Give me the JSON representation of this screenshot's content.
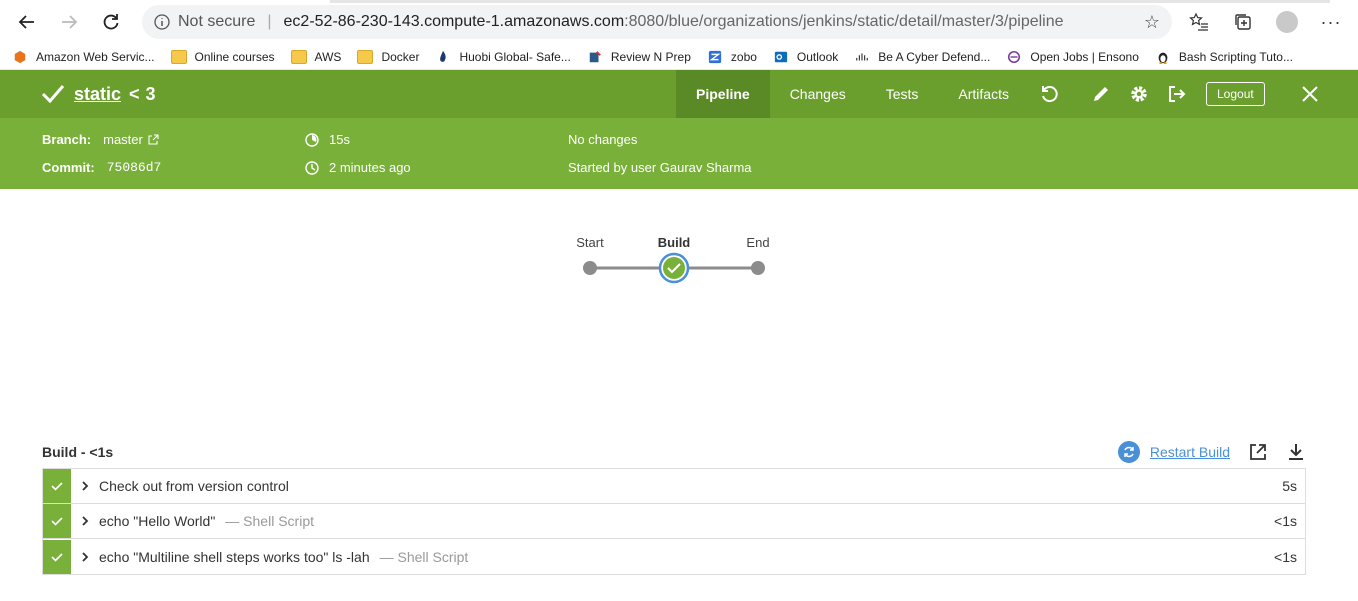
{
  "browser": {
    "security": "Not secure",
    "url_host": "ec2-52-86-230-143.compute-1.amazonaws.com",
    "url_rest": ":8080/blue/organizations/jenkins/static/detail/master/3/pipeline",
    "bookmarks": [
      {
        "label": "Amazon Web Servic...",
        "icon": "aws-icon"
      },
      {
        "label": "Online courses",
        "icon": "folder-icon"
      },
      {
        "label": "AWS",
        "icon": "folder-icon"
      },
      {
        "label": "Docker",
        "icon": "folder-icon"
      },
      {
        "label": "Huobi Global- Safe...",
        "icon": "huobi-icon"
      },
      {
        "label": "Review N Prep",
        "icon": "review-icon"
      },
      {
        "label": "zobo",
        "icon": "zobo-icon"
      },
      {
        "label": "Outlook",
        "icon": "outlook-icon"
      },
      {
        "label": "Be A Cyber Defend...",
        "icon": "cisco-icon"
      },
      {
        "label": "Open Jobs | Ensono",
        "icon": "ensono-icon"
      },
      {
        "label": "Bash Scripting Tuto...",
        "icon": "linux-icon"
      }
    ]
  },
  "header": {
    "job": "static",
    "separator": "<",
    "run": "3",
    "tabs": [
      "Pipeline",
      "Changes",
      "Tests",
      "Artifacts"
    ],
    "active_tab": "Pipeline",
    "logout": "Logout",
    "color": "#6a9f2e"
  },
  "info": {
    "branch_label": "Branch:",
    "branch": "master",
    "commit_label": "Commit:",
    "commit": "75086d7",
    "duration": "15s",
    "time": "2 minutes ago",
    "changes": "No changes",
    "started": "Started by user Gaurav Sharma"
  },
  "pipeline": {
    "stages": [
      "Start",
      "Build",
      "End"
    ],
    "current": "Build"
  },
  "steps_panel": {
    "title": "Build - <1s",
    "restart": "Restart Build",
    "steps": [
      {
        "name": "Check out from version control",
        "sub": "",
        "duration": "5s"
      },
      {
        "name": "echo \"Hello World\"",
        "sub": "— Shell Script",
        "duration": "<1s"
      },
      {
        "name": "echo \"Multiline shell steps works too\" ls -lah",
        "sub": "— Shell Script",
        "duration": "<1s"
      }
    ]
  }
}
